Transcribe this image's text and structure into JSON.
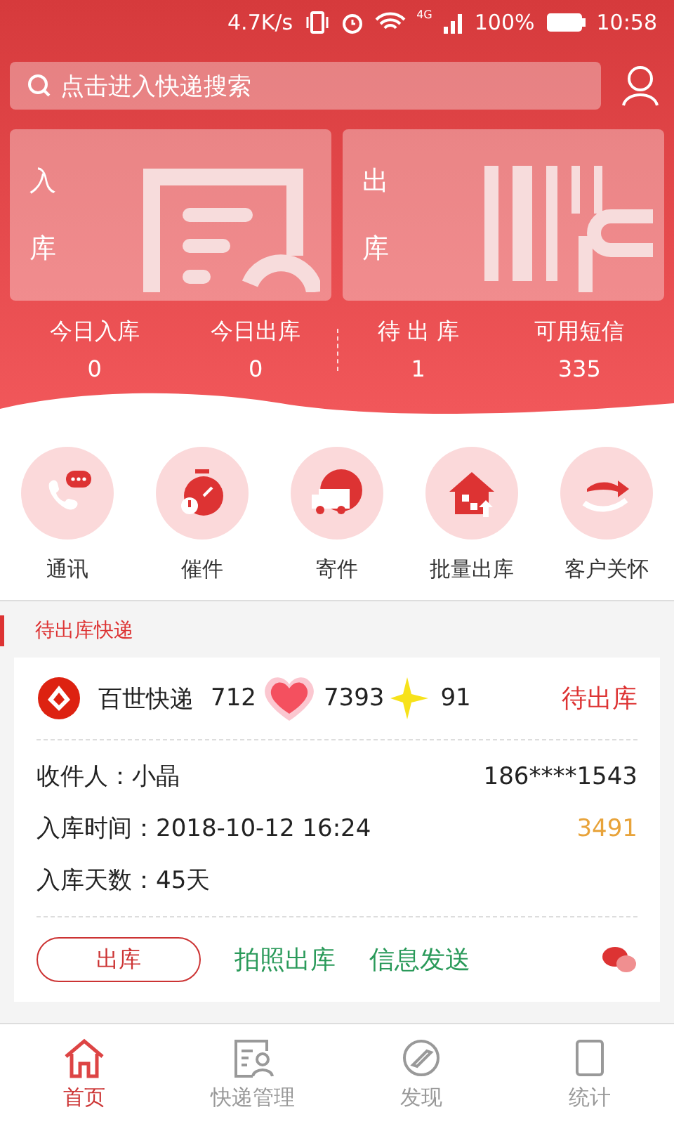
{
  "status_bar": {
    "speed": "4.7K/s",
    "network": "4G",
    "battery": "100%",
    "time": "10:58"
  },
  "search": {
    "placeholder": "点击进入快递搜索"
  },
  "tiles": [
    {
      "kind": "in",
      "chars": [
        "入",
        "库"
      ]
    },
    {
      "kind": "out",
      "chars": [
        "出",
        "库"
      ]
    }
  ],
  "stats": [
    {
      "label": "今日入库",
      "value": "0"
    },
    {
      "label": "今日出库",
      "value": "0"
    },
    {
      "label": "待 出 库",
      "value": "1"
    },
    {
      "label": "可用短信",
      "value": "335"
    }
  ],
  "shortcuts": [
    {
      "kind": "call",
      "label": "通讯"
    },
    {
      "kind": "urge",
      "label": "催件"
    },
    {
      "kind": "send",
      "label": "寄件"
    },
    {
      "kind": "batch",
      "label": "批量出库"
    },
    {
      "kind": "care",
      "label": "客户关怀"
    }
  ],
  "section_title": "待出库快递",
  "parcel": {
    "carrier": "百世快递",
    "tracking_parts": [
      "712",
      "7393",
      "91"
    ],
    "status": "待出库",
    "recipient": "收件人：小晶",
    "phone": "186****1543",
    "time": "入库时间：2018-10-12 16:24",
    "code": "3491",
    "days": "入库天数：45天",
    "actions": [
      "出库",
      "拍照出库",
      "信息发送"
    ]
  },
  "nav": [
    {
      "kind": "home",
      "label": "首页",
      "selected": true
    },
    {
      "kind": "manage",
      "label": "快递管理",
      "selected": false
    },
    {
      "kind": "discover",
      "label": "发现",
      "selected": false
    },
    {
      "kind": "stats",
      "label": "统计",
      "selected": false
    }
  ]
}
